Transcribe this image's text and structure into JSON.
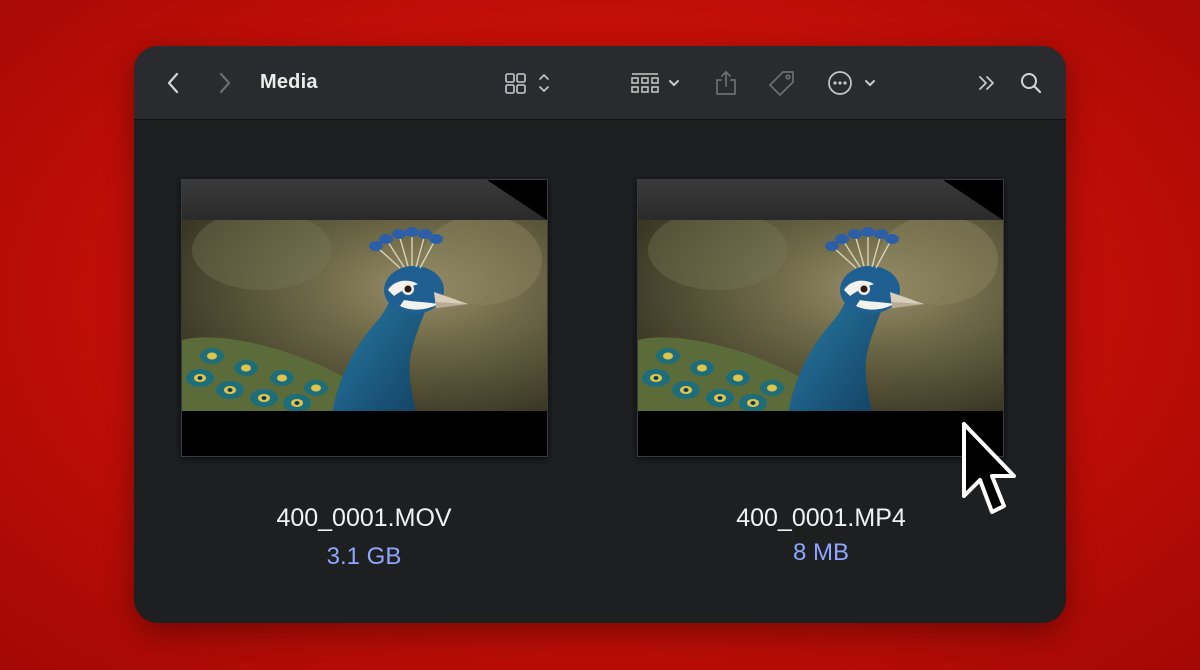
{
  "toolbar": {
    "title": "Media",
    "buttons": [
      "back",
      "forward",
      "view-mode",
      "group",
      "share",
      "tag",
      "more",
      "expand",
      "search"
    ]
  },
  "files": [
    {
      "name": "400_0001.MOV",
      "size": "3.1 GB"
    },
    {
      "name": "400_0001.MP4",
      "size": "8 MB"
    }
  ],
  "colors": {
    "background": "#cc1108",
    "window": "#1d1f21",
    "toolbar": "#2a2b2e",
    "size_text": "#8ea6ff"
  }
}
